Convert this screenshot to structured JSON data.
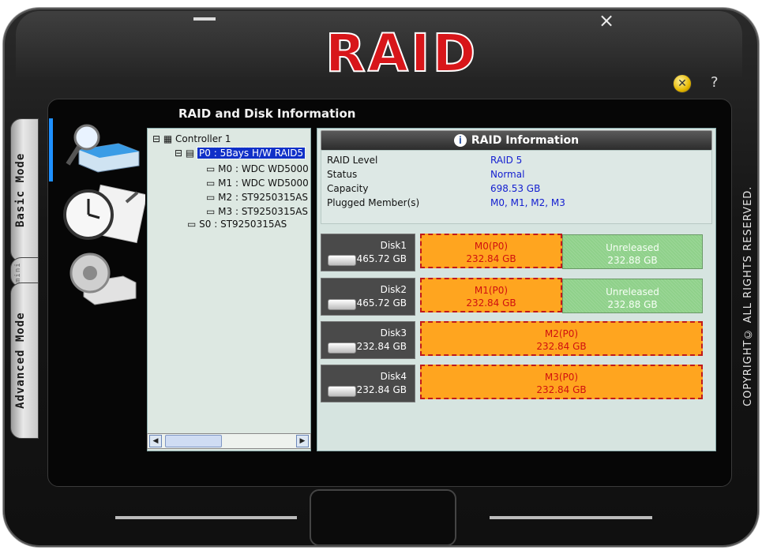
{
  "window": {
    "title": "RAID",
    "minimize_label": "",
    "close_label": "×"
  },
  "header": {
    "logo_text": "RAID",
    "section_title": "RAID and Disk Information",
    "help_label": "?"
  },
  "side_tabs": {
    "basic": "Basic Mode",
    "mini": "mini",
    "advanced": "Advanced Mode"
  },
  "copyright": "COPYRIGHT© ALL RIGHTS RESERVED.",
  "tree": {
    "controller": "Controller 1",
    "raid": "P0 : 5Bays H/W RAID5",
    "members": [
      "M0 : WDC WD5000",
      "M1 : WDC WD5000",
      "M2 : ST9250315AS",
      "M3 : ST9250315AS"
    ],
    "spare": "S0 : ST9250315AS"
  },
  "raid_info": {
    "header": "RAID Information",
    "rows": [
      {
        "label": "RAID Level",
        "value": "RAID 5"
      },
      {
        "label": "Status",
        "value": "Normal"
      },
      {
        "label": "Capacity",
        "value": "698.53 GB"
      },
      {
        "label": "Plugged Member(s)",
        "value": "M0, M1, M2, M3"
      }
    ]
  },
  "disks": [
    {
      "name": "Disk1",
      "size": "465.72 GB",
      "member": "M0(P0)",
      "member_size": "232.84 GB",
      "unreleased": "Unreleased",
      "unreleased_size": "232.88 GB"
    },
    {
      "name": "Disk2",
      "size": "465.72 GB",
      "member": "M1(P0)",
      "member_size": "232.84 GB",
      "unreleased": "Unreleased",
      "unreleased_size": "232.88 GB"
    },
    {
      "name": "Disk3",
      "size": "232.84 GB",
      "member": "M2(P0)",
      "member_size": "232.84 GB"
    },
    {
      "name": "Disk4",
      "size": "232.84 GB",
      "member": "M3(P0)",
      "member_size": "232.84 GB"
    }
  ],
  "colors": {
    "member": "#ffa51f",
    "member_border": "#c21a1a",
    "unreleased": "#8fd18a",
    "selected": "#1030c8",
    "logo": "#d8161a"
  }
}
